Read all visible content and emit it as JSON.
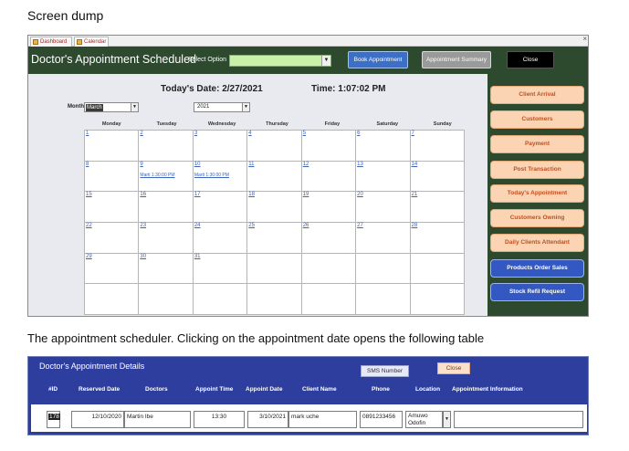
{
  "doc": {
    "heading": "Screen dump",
    "caption": "The appointment scheduler. Clicking on the appointment date opens the following table"
  },
  "calendar_form": {
    "tabs": [
      "Dashboard",
      "Calendar"
    ],
    "window_close": "×",
    "title": "Doctor's Appointment Scheduled",
    "select_option_label": "Select Option",
    "select_option_value": "",
    "buttons": {
      "book": "Book Appointment",
      "summary": "Appointment Summary",
      "close": "Close"
    },
    "today_label": "Today's Date: 2/27/2021",
    "time_label": "Time:  1:07:02 PM",
    "month_label": "Month",
    "month_value": "March",
    "year_value": "2021",
    "weekdays": [
      "Monday",
      "Tuesday",
      "Wednesday",
      "Thursday",
      "Friday",
      "Saturday",
      "Sunday"
    ],
    "weeks": [
      [
        {
          "d": "1"
        },
        {
          "d": "2"
        },
        {
          "d": "3"
        },
        {
          "d": "4"
        },
        {
          "d": "5"
        },
        {
          "d": "6"
        },
        {
          "d": "7"
        }
      ],
      [
        {
          "d": "8"
        },
        {
          "d": "9",
          "a": "Marti 1:30:00 PM"
        },
        {
          "d": "10",
          "a": "Marti 1:30:00 PM"
        },
        {
          "d": "11"
        },
        {
          "d": "12"
        },
        {
          "d": "13"
        },
        {
          "d": "14"
        }
      ],
      [
        {
          "d": "15"
        },
        {
          "d": "16"
        },
        {
          "d": "17"
        },
        {
          "d": "18"
        },
        {
          "d": "19"
        },
        {
          "d": "20"
        },
        {
          "d": "21"
        }
      ],
      [
        {
          "d": "22"
        },
        {
          "d": "23"
        },
        {
          "d": "24"
        },
        {
          "d": "25"
        },
        {
          "d": "26"
        },
        {
          "d": "27"
        },
        {
          "d": "28"
        }
      ],
      [
        {
          "d": "29"
        },
        {
          "d": "30"
        },
        {
          "d": "31"
        },
        {
          "d": ""
        },
        {
          "d": ""
        },
        {
          "d": ""
        },
        {
          "d": ""
        }
      ],
      [
        {
          "d": ""
        },
        {
          "d": ""
        },
        {
          "d": ""
        },
        {
          "d": ""
        },
        {
          "d": ""
        },
        {
          "d": ""
        },
        {
          "d": ""
        }
      ]
    ],
    "side_buttons": [
      {
        "label": "Client Arrival",
        "style": "peach"
      },
      {
        "label": "Customers",
        "style": "peach"
      },
      {
        "label": "Payment",
        "style": "peach"
      },
      {
        "label": "Post Transaction",
        "style": "peach"
      },
      {
        "label": "Today's Appointment",
        "style": "peach"
      },
      {
        "label": "Customers Owning",
        "style": "peach"
      },
      {
        "label": "Daily Clients Attendant",
        "style": "peach"
      },
      {
        "label": "Products Order Sales",
        "style": "blue"
      },
      {
        "label": "Stock Refil Request",
        "style": "blue"
      }
    ],
    "colors": {
      "title_bar": "#2d4a2f",
      "calendar_bg": "#e9eaf0",
      "peach": "#fbd4b4",
      "blue": "#3458c2"
    }
  },
  "details": {
    "title": "Doctor's Appointment Details",
    "sms_button": "SMS Number",
    "close_button": "Close",
    "columns": [
      "#ID",
      "Reserved Date",
      "Doctors",
      "Appoint Time",
      "Appoint Date",
      "Client Name",
      "Phone",
      "Location",
      "Appointment Information"
    ],
    "row": {
      "id": "178",
      "reserved_date": "12/10/2020",
      "doctor": "Martin Ibe",
      "appoint_time": "13:30",
      "appoint_date": "3/10/2021",
      "client_name": "mark uche",
      "phone": "0891233456",
      "location": "Amuwo Odofin",
      "appointment_information": ""
    },
    "colors": {
      "background": "#2e3e9e"
    }
  }
}
